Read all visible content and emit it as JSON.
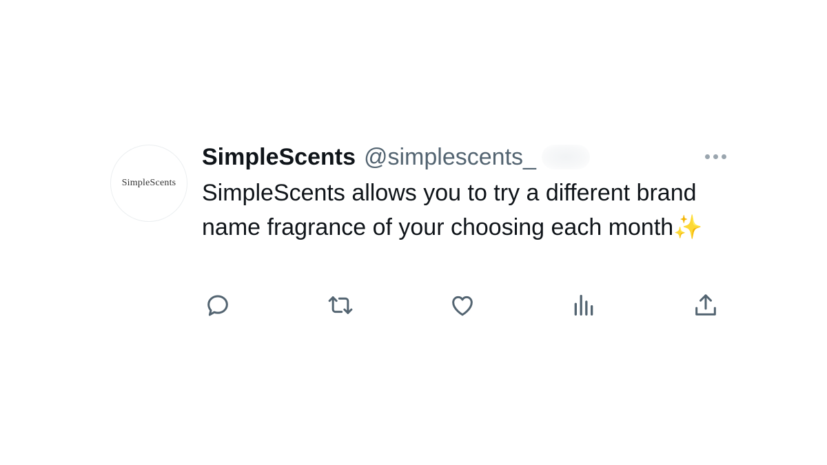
{
  "tweet": {
    "avatar_logo_text": "SimpleScents",
    "display_name": "SimpleScents",
    "handle": "@simplescents_",
    "text": "SimpleScents allows you to try a different brand name fragrance of your choosing each month✨",
    "more_icon": "more-horizontal-icon",
    "actions": [
      {
        "name": "reply-icon"
      },
      {
        "name": "retweet-icon"
      },
      {
        "name": "like-icon"
      },
      {
        "name": "analytics-icon"
      },
      {
        "name": "share-icon"
      }
    ]
  },
  "colors": {
    "text_primary": "#0f1419",
    "text_secondary": "#536471",
    "icon": "#536471",
    "background": "#ffffff"
  }
}
